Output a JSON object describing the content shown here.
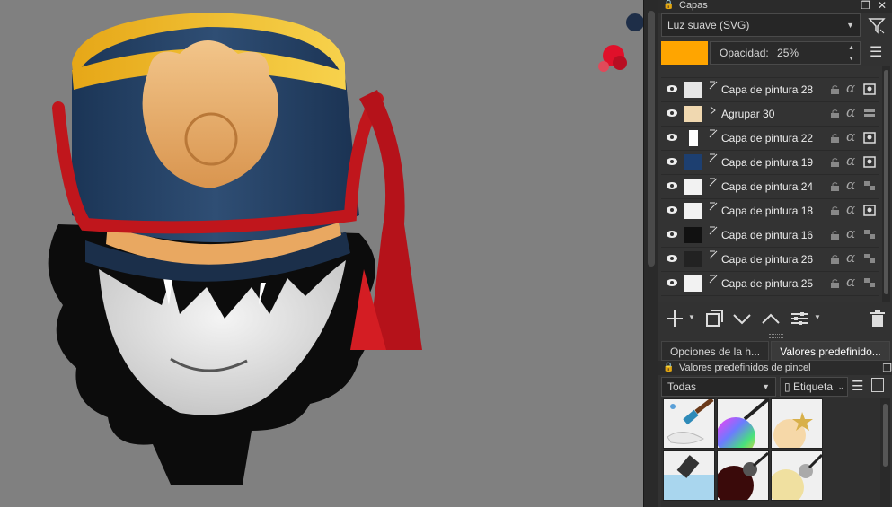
{
  "layers_panel": {
    "title": "Capas",
    "blend_mode": "Luz suave (SVG)",
    "opacity_label": "Opacidad:",
    "opacity_value": "25%",
    "swatch_color": "#FFA500",
    "layers": [
      {
        "name": "Capa de pintura 28",
        "type": "paint"
      },
      {
        "name": "Agrupar 30",
        "type": "group"
      },
      {
        "name": "Capa de pintura 22",
        "type": "paint"
      },
      {
        "name": "Capa de pintura 19",
        "type": "paint"
      },
      {
        "name": "Capa de pintura 24",
        "type": "paint"
      },
      {
        "name": "Capa de pintura 18",
        "type": "paint"
      },
      {
        "name": "Capa de pintura 16",
        "type": "paint"
      },
      {
        "name": "Capa de pintura 26",
        "type": "paint"
      },
      {
        "name": "Capa de pintura 25",
        "type": "paint"
      }
    ],
    "alpha_glyph": "α"
  },
  "tabs": {
    "tab1": "Opciones de la h...",
    "tab2": "Valores predefinido..."
  },
  "brush_presets": {
    "title": "Valores predefinidos de pincel",
    "filter": "Todas",
    "tag_label": "Etiqueta"
  }
}
